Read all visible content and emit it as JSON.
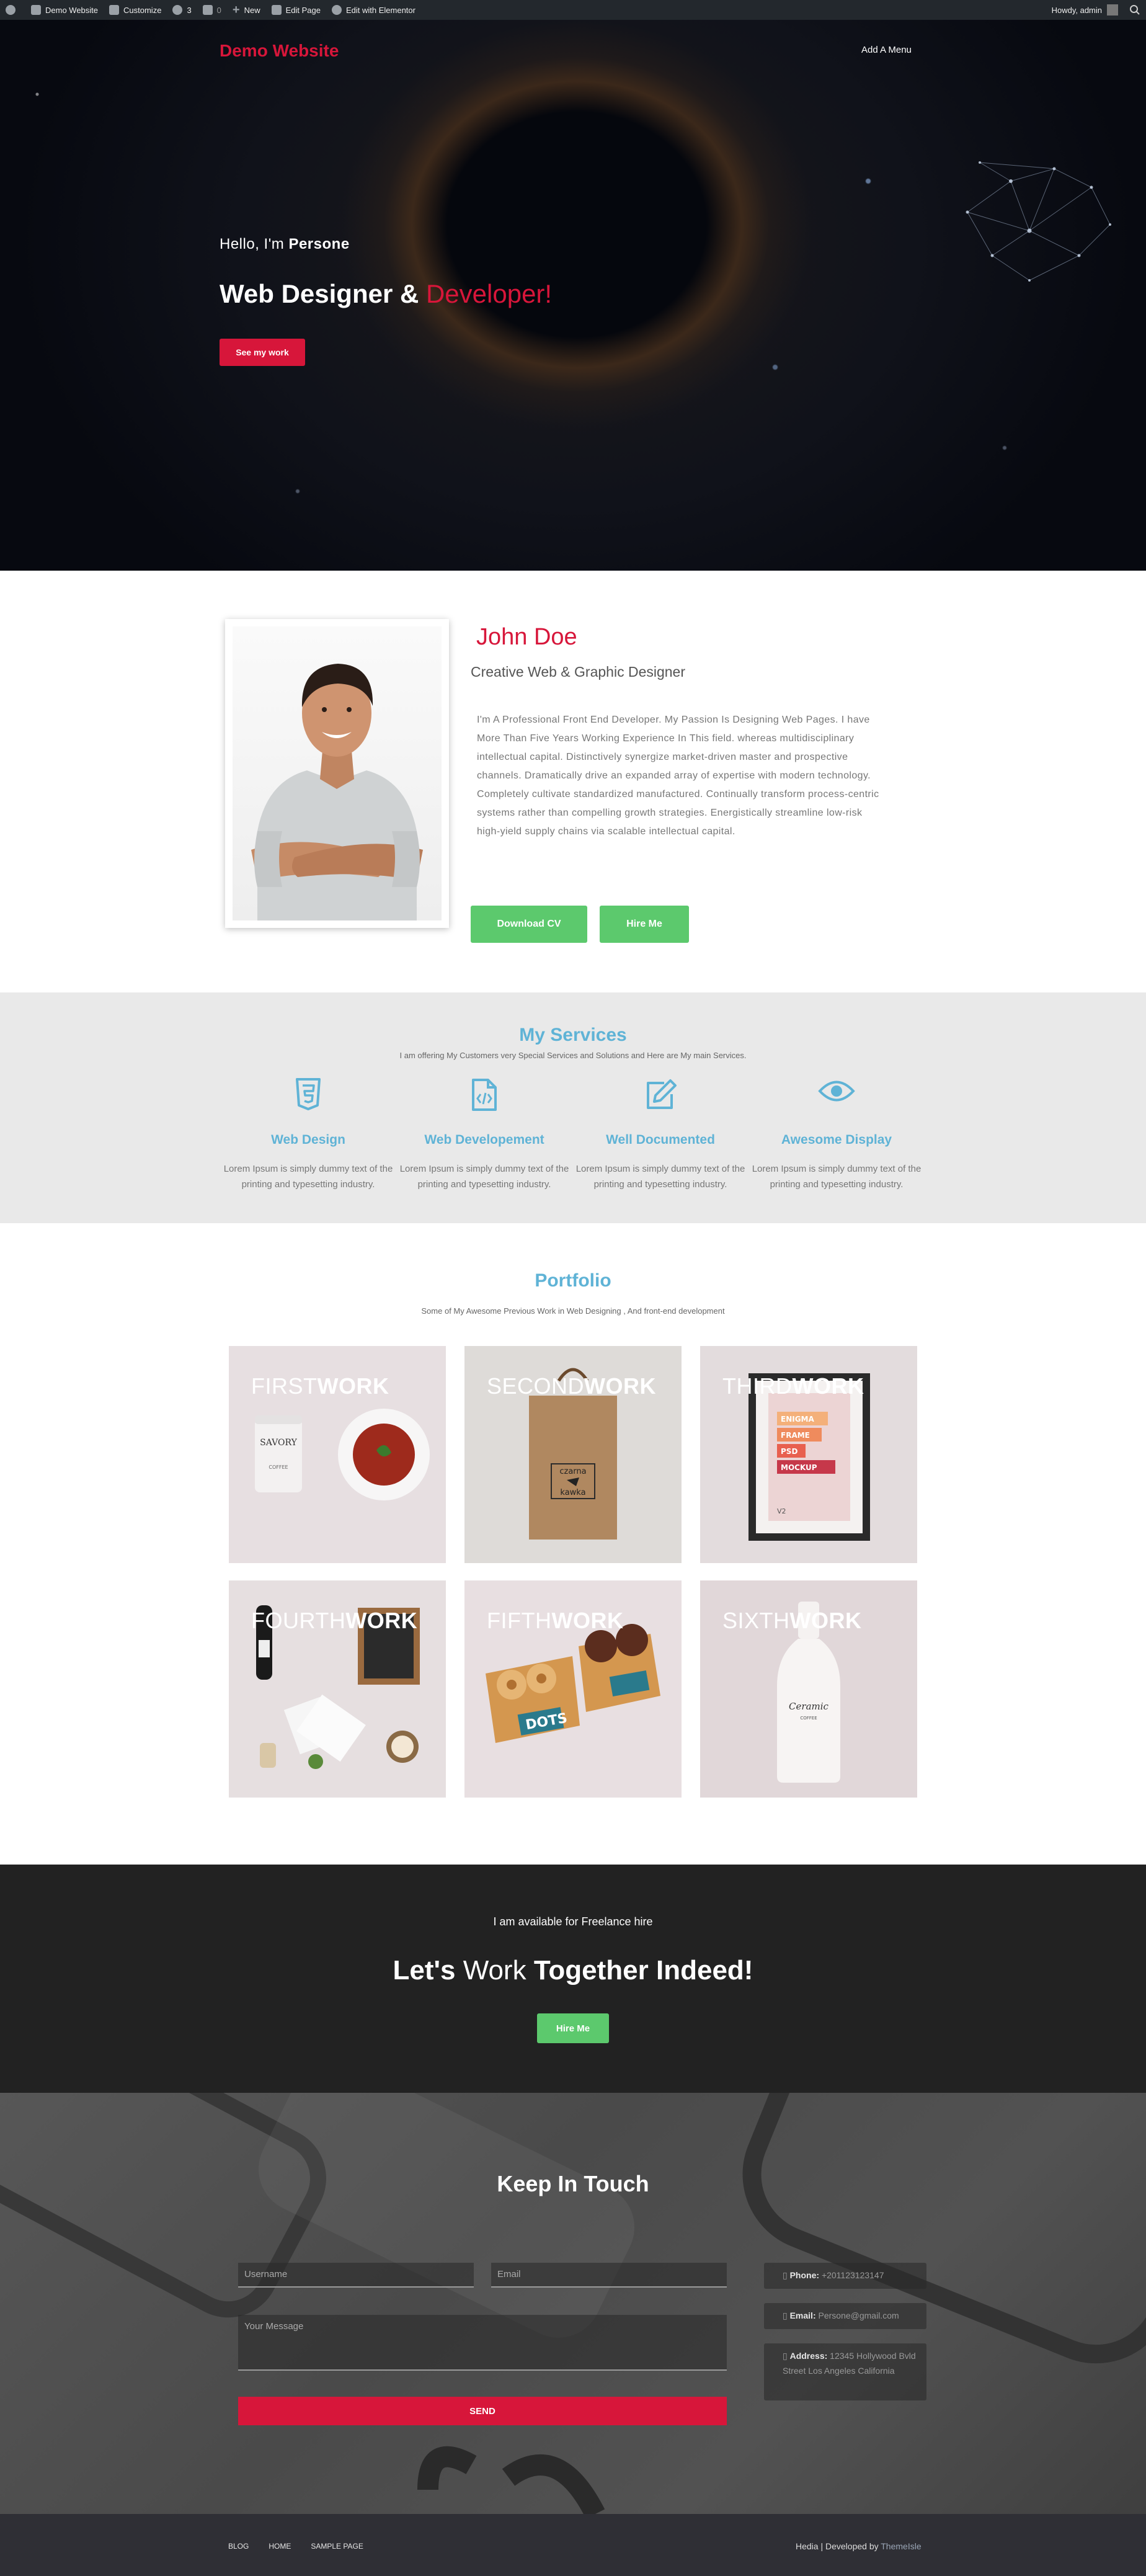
{
  "adminbar": {
    "site": "Demo Website",
    "customize": "Customize",
    "updates": "3",
    "comments": "0",
    "new": "New",
    "edit_page": "Edit Page",
    "elementor": "Edit with Elementor",
    "howdy": "Howdy, admin"
  },
  "hero": {
    "logo": "Demo Website",
    "menu": "Add A Menu",
    "hello_prefix": "Hello, I'm",
    "hello_name": "Persone",
    "title_main": "Web Designer &",
    "title_accent": "Developer!",
    "cta": "See my work"
  },
  "about": {
    "name": "John Doe",
    "role": "Creative Web & Graphic Designer",
    "bio": "I'm A Professional Front End Developer. My Passion Is Designing Web Pages. I have More Than Five Years Working Experience In This field. whereas multidisciplinary intellectual capital. Distinctively synergize market-driven master and prospective channels. Dramatically drive an expanded array of expertise with modern technology. Completely cultivate standardized manufactured. Continually transform process-centric systems rather than compelling growth strategies. Energistically streamline low-risk high-yield supply chains via scalable intellectual capital.",
    "download_cv": "Download CV",
    "hire_me": "Hire Me"
  },
  "services": {
    "title": "My Services",
    "subtitle": "I am offering My Customers very Special Services and Solutions and Here are My main Services.",
    "items": [
      {
        "icon": "html5-icon",
        "title": "Web Design",
        "desc": "Lorem Ipsum is simply dummy text of the printing and typesetting industry."
      },
      {
        "icon": "code-file-icon",
        "title": "Web Developement",
        "desc": "Lorem Ipsum is simply dummy text of the printing and typesetting industry."
      },
      {
        "icon": "edit-icon",
        "title": "Well Documented",
        "desc": "Lorem Ipsum is simply dummy text of the printing and typesetting industry."
      },
      {
        "icon": "eye-icon",
        "title": "Awesome Display",
        "desc": "Lorem Ipsum is simply dummy text of the printing and typesetting industry."
      }
    ]
  },
  "portfolio": {
    "title": "Portfolio",
    "subtitle": "Some of My Awesome Previous Work in Web Designing , And front-end development",
    "items": [
      {
        "light": "FIRST",
        "bold": "WORK"
      },
      {
        "light": "SECOND",
        "bold": "WORK"
      },
      {
        "light": "THIRD",
        "bold": "WORK"
      },
      {
        "light": "FOURTH",
        "bold": "WORK"
      },
      {
        "light": "FIFTH",
        "bold": "WORK"
      },
      {
        "light": "SIXTH",
        "bold": "WORK"
      }
    ],
    "art_text": {
      "savory": "SAVORY",
      "coffee": "COFFEE",
      "czarna": "czarna",
      "kawka": "kawka",
      "frame_lines": [
        "ENIGMA",
        "FRAME",
        "PSD",
        "MOCKUP"
      ],
      "v2": "V2",
      "dots": "DOTS",
      "ceramic": "Ceramic",
      "ceramic_sub": "COFFEE"
    }
  },
  "freelance": {
    "subtitle": "I am available for Freelance hire",
    "title_b1": "Let's",
    "title_n1": "Work",
    "title_b2": "Together Indeed!",
    "cta": "Hire Me"
  },
  "contact": {
    "title": "Keep In Touch",
    "username_ph": "Username",
    "email_ph": "Email",
    "message_ph": "Your Message",
    "send": "SEND",
    "phone_label": "Phone:",
    "phone": "+201123123147",
    "email_label": "Email:",
    "email": "Persone@gmail.com",
    "address_label": "Address:",
    "address": "12345 Hollywood Bvld Street Los Angeles California"
  },
  "footer": {
    "nav": [
      "BLOG",
      "HOME",
      "SAMPLE PAGE"
    ],
    "copy": "Hedia | Developed by",
    "brand": "ThemeIsle"
  },
  "colors": {
    "accent_red": "#d7163a",
    "accent_blue": "#5fb3d6",
    "accent_green": "#5cc96d"
  }
}
